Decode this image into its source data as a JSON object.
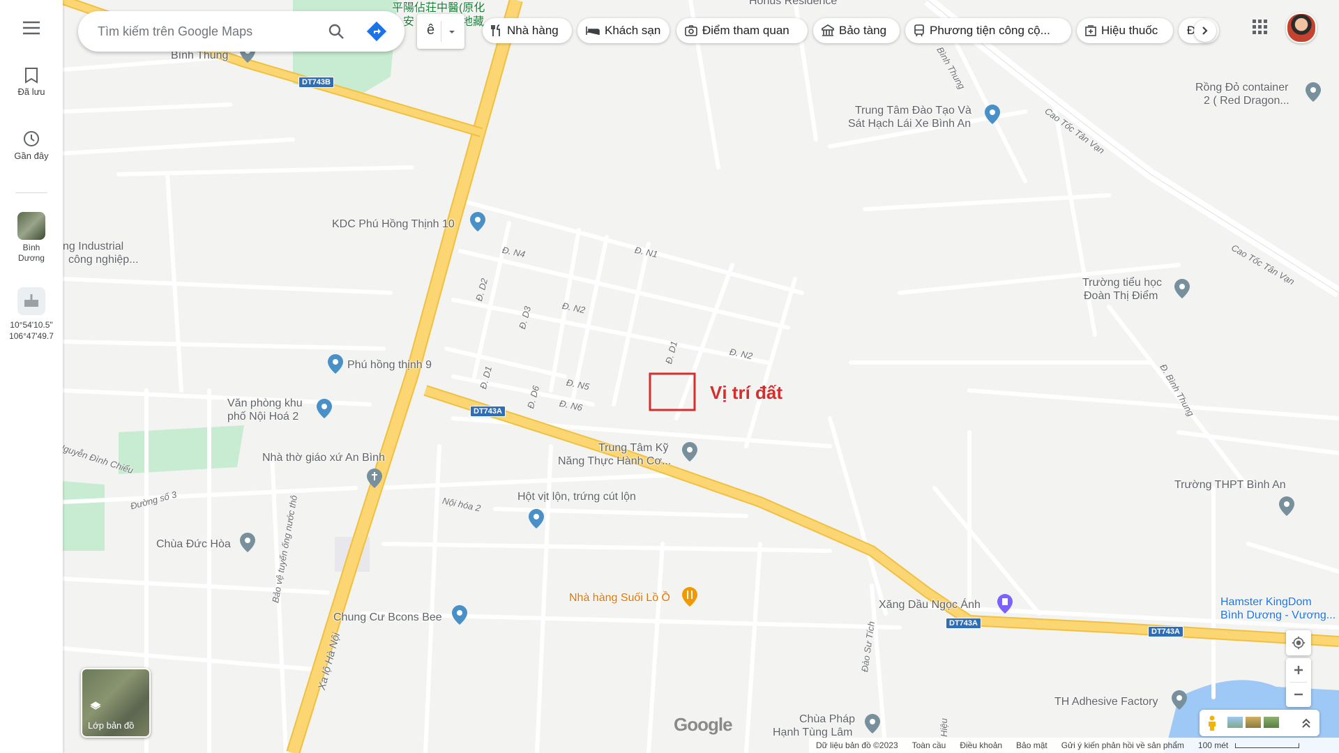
{
  "sidebar": {
    "menu_icon": "menu-icon",
    "saved_label": "Đã lưu",
    "recent_label": "Gần đây",
    "recent_place_label": "Bình Dương",
    "coords_line1": "10°54'10.5\"",
    "coords_line2": "106°47'49.7"
  },
  "search": {
    "placeholder": "Tìm kiếm trên Google Maps"
  },
  "filters": {
    "chip_partial": "ê",
    "chips": [
      "Nhà hàng",
      "Khách sạn",
      "Điểm tham quan",
      "Bảo tàng",
      "Phương tiện công cộ...",
      "Hiệu thuốc",
      "Đ"
    ]
  },
  "map": {
    "annotation": "Vị trí đất",
    "places": {
      "binh_thung": "Bình Thung",
      "kdc_phu_hong_thinh": "KDC Phú Hồng Thịnh 10",
      "industrial_1": "ng Industrial",
      "industrial_2": "công nghiệp...",
      "phu_hong_thinh_9": "Phú hồng thịnh 9",
      "van_phong_1": "Văn phòng khu",
      "van_phong_2": "phố Nội Hoá 2",
      "nha_tho": "Nhà thờ giáo xứ An Bình",
      "trung_tam_ky_1": "Trung Tâm Kỹ",
      "trung_tam_ky_2": "Năng Thực Hành Cơ...",
      "hot_vit": "Hột vịt lộn, trứng cút lộn",
      "chua_duc_hoa": "Chùa Đức Hòa",
      "chung_cu": "Chung Cư Bcons Bee",
      "nha_hang_suoi": "Nhà hàng Suối Lồ Ồ",
      "xang_dau": "Xăng Dầu Ngọc Ánh",
      "chua_phap_1": "Chùa Pháp",
      "chua_phap_2": "Hạnh Tùng Lâm",
      "th_adhesive": "TH Adhesive Factory",
      "hamster_1": "Hamster KingDom",
      "hamster_2": "Bình Dương - Vương...",
      "truong_thpt": "Trường THPT Bình An",
      "truong_tieu_hoc_1": "Trường tiểu học",
      "truong_tieu_hoc_2": "Đoàn Thị Điểm",
      "trung_tam_dao_tao_1": "Trung Tâm Đào Tạo Và",
      "trung_tam_dao_tao_2": "Sát Hạch Lái Xe Bình An",
      "rong_do_1": "Rồng Đỏ container",
      "rong_do_2": "2 ( Red Dragon...",
      "honus": "Honus Residence",
      "chinese_1": "平陽佔荘中醫(原化",
      "chinese_2": "安",
      "chinese_3": "地藏"
    },
    "roads": {
      "n4": "Đ. N4",
      "n1": "Đ. N1",
      "n2a": "Đ. N2",
      "n2b": "Đ. N2",
      "n5": "Đ. N5",
      "n6": "Đ. N6",
      "d1a": "Đ. D1",
      "d1b": "Đ. D1",
      "d2": "Đ. D2",
      "d3": "Đ. D3",
      "d6": "Đ. D6",
      "noi_hoa_2": "Nội hóa 2",
      "duong_so_3": "Đường số 3",
      "nguyen_dinh_chieu": "Nguyễn Đình Chiểu",
      "xa_lo_ha_noi": "Xa lộ Hà Nội",
      "cao_toc_1": "Cao Tốc Tân Vạn",
      "cao_toc_2": "Cao Tốc Tân Vạn",
      "binh_thung_rd_1": "Đ. Bình Thung",
      "binh_thung_rd_2": "Bình Thung",
      "bao_ve": "Bảo vệ tuyến ống nước thô",
      "dao_su_tich": "Đào Sư Tích",
      "hieu": "Hiệu"
    },
    "shields": {
      "dt743b": "DT743B",
      "dt743a_1": "DT743A",
      "dt743a_2": "DT743A",
      "dt743a_3": "DT743A"
    },
    "google_logo": "Google",
    "layers_label": "Lớp bản đồ"
  },
  "footer": {
    "data": "Dữ liệu bản đồ ©2023",
    "global": "Toàn cầu",
    "terms": "Điều khoản",
    "privacy": "Bảo mật",
    "feedback": "Gửi ý kiến phản hồi về sản phẩm",
    "scale": "100 mét"
  },
  "colors": {
    "highway": "#fcd672",
    "highway_border": "#f0c040",
    "road": "#ffffff",
    "park": "#c8ecd2",
    "water": "#9ec8f5",
    "pin_blue": "#4a90c8",
    "pin_gray": "#78909c",
    "pin_orange": "#f29900",
    "annotation_red": "#d32f2f"
  }
}
